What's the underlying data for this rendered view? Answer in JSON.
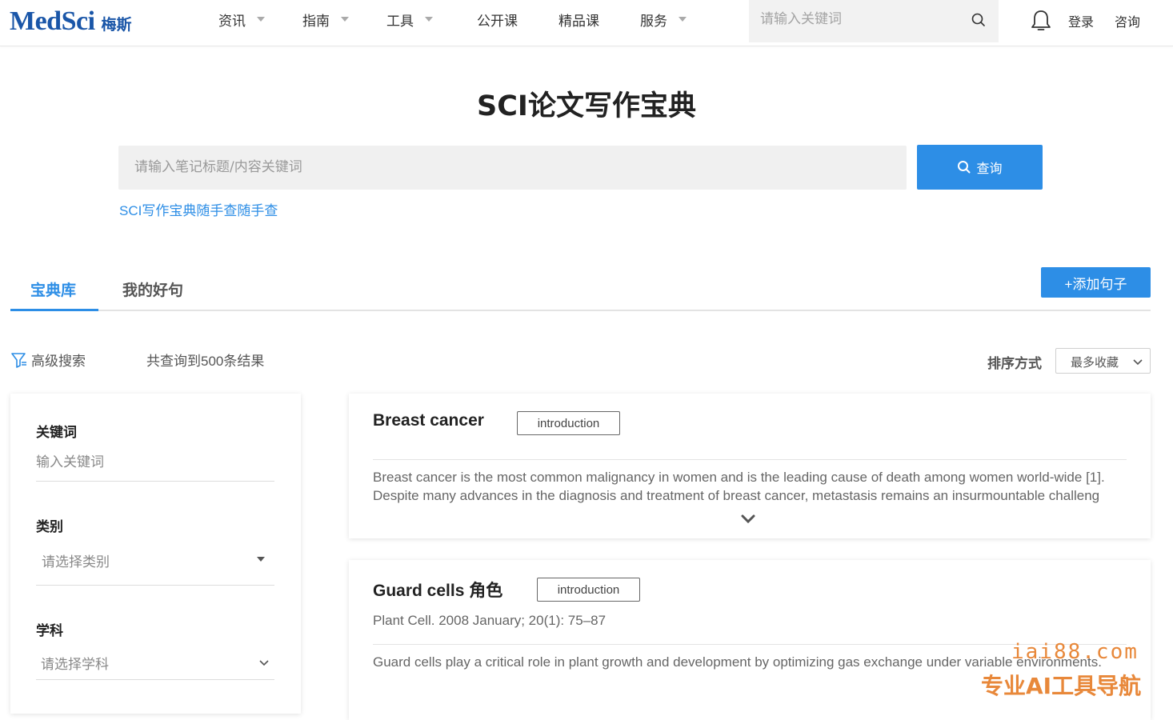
{
  "header": {
    "logo_main": "MedSci",
    "logo_sub": "梅斯",
    "nav": [
      {
        "label": "资讯",
        "has_dropdown": true
      },
      {
        "label": "指南",
        "has_dropdown": true
      },
      {
        "label": "工具",
        "has_dropdown": true
      },
      {
        "label": "公开课",
        "has_dropdown": false
      },
      {
        "label": "精品课",
        "has_dropdown": false
      },
      {
        "label": "服务",
        "has_dropdown": true
      }
    ],
    "search_placeholder": "请输入关键词",
    "login": "登录",
    "consult": "咨询"
  },
  "page_title": "SCI论文写作宝典",
  "main_search": {
    "placeholder": "请输入笔记标题/内容关键词",
    "button": "查询"
  },
  "sub_link": "SCI写作宝典随手查随手查",
  "tabs": [
    {
      "label": "宝典库",
      "active": true
    },
    {
      "label": "我的好句",
      "active": false
    }
  ],
  "add_button": "+添加句子",
  "filter": {
    "advanced": "高级搜索",
    "result_count": "共查询到500条结果",
    "sort_label": "排序方式",
    "sort_value": "最多收藏"
  },
  "sidebar": {
    "keyword_label": "关键词",
    "keyword_placeholder": "输入关键词",
    "category_label": "类别",
    "category_placeholder": "请选择类别",
    "subject_label": "学科",
    "subject_placeholder": "请选择学科"
  },
  "cards": [
    {
      "title": "Breast cancer",
      "tag": "introduction",
      "meta": "",
      "text_lines": [
        "Breast cancer is the most common malignancy in women and is the leading cause of death among women world-wide [1].",
        "Despite many advances in the diagnosis and treatment of breast cancer, metastasis remains an insurmountable challeng"
      ]
    },
    {
      "title": "Guard cells 角色",
      "tag": "introduction",
      "meta": "Plant Cell. 2008 January; 20(1): 75–87",
      "text_lines": [
        "Guard cells play a critical role in plant growth and development by optimizing gas exchange under variable environments."
      ]
    }
  ],
  "watermark": {
    "line1": "iai88.com",
    "line2": "专业AI工具导航"
  },
  "colors": {
    "accent": "#2d8ee6",
    "logo": "#1a56a8",
    "watermark": "#e8883a"
  }
}
